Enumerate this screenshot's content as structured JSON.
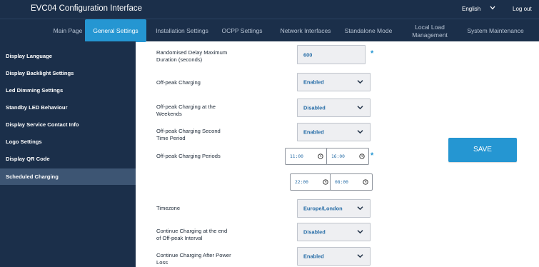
{
  "app": {
    "title": "EVC04 Configuration Interface",
    "language": "English",
    "logout_label": "Log out"
  },
  "nav": {
    "tabs": [
      {
        "label": "Main Page"
      },
      {
        "label": "General Settings"
      },
      {
        "label": "Installation Settings"
      },
      {
        "label": "OCPP Settings"
      },
      {
        "label": "Network Interfaces"
      },
      {
        "label": "Standalone Mode"
      },
      {
        "label_line1": "Local Load",
        "label_line2": "Management"
      },
      {
        "label": "System Maintenance"
      }
    ],
    "active": "General Settings"
  },
  "sidebar": {
    "items": [
      {
        "label": "Display Language"
      },
      {
        "label": "Display Backlight Settings"
      },
      {
        "label": "Led Dimming Settings"
      },
      {
        "label": "Standby LED Behaviour"
      },
      {
        "label": "Display Service Contact Info"
      },
      {
        "label": "Logo Settings"
      },
      {
        "label": "Display QR Code"
      },
      {
        "label": "Scheduled Charging"
      }
    ],
    "active": "Scheduled Charging"
  },
  "form": {
    "random_delay": {
      "label_line1": "Randomised Delay Maximum",
      "label_line2": "Duration (seconds)",
      "value": "600"
    },
    "offpeak_charging": {
      "label": "Off-peak Charging",
      "value": "Enabled"
    },
    "offpeak_weekends": {
      "label_line1": "Off-peak Charging at the",
      "label_line2": "Weekends",
      "value": "Disabled"
    },
    "offpeak_second": {
      "label_line1": "Off-peak Charging Second",
      "label_line2": "Time Period",
      "value": "Enabled"
    },
    "offpeak_periods": {
      "label": "Off-peak Charging Periods",
      "period1_start": "11:00",
      "period1_end": "16:00",
      "period2_start": "22:00",
      "period2_end": "08:00"
    },
    "timezone": {
      "label": "Timezone",
      "value": "Europe/London"
    },
    "continue_end": {
      "label_line1": "Continue Charging at the end",
      "label_line2": "of Off-peak Interval",
      "value": "Disabled"
    },
    "continue_power": {
      "label_line1": "Continue Charging After Power",
      "label_line2": "Loss",
      "value": "Enabled"
    },
    "required_marker": "*"
  },
  "save_label": "SAVE",
  "colors": {
    "navy": "#1b2f4a",
    "accent": "#2596d2",
    "sidebar_active": "#3d5573",
    "field_bg": "#eeeff2",
    "value_text": "#2a6fa8"
  },
  "icons": {
    "dropdown": "chevron-down-icon",
    "time": "clock-icon",
    "language": "chevron-down-icon"
  }
}
